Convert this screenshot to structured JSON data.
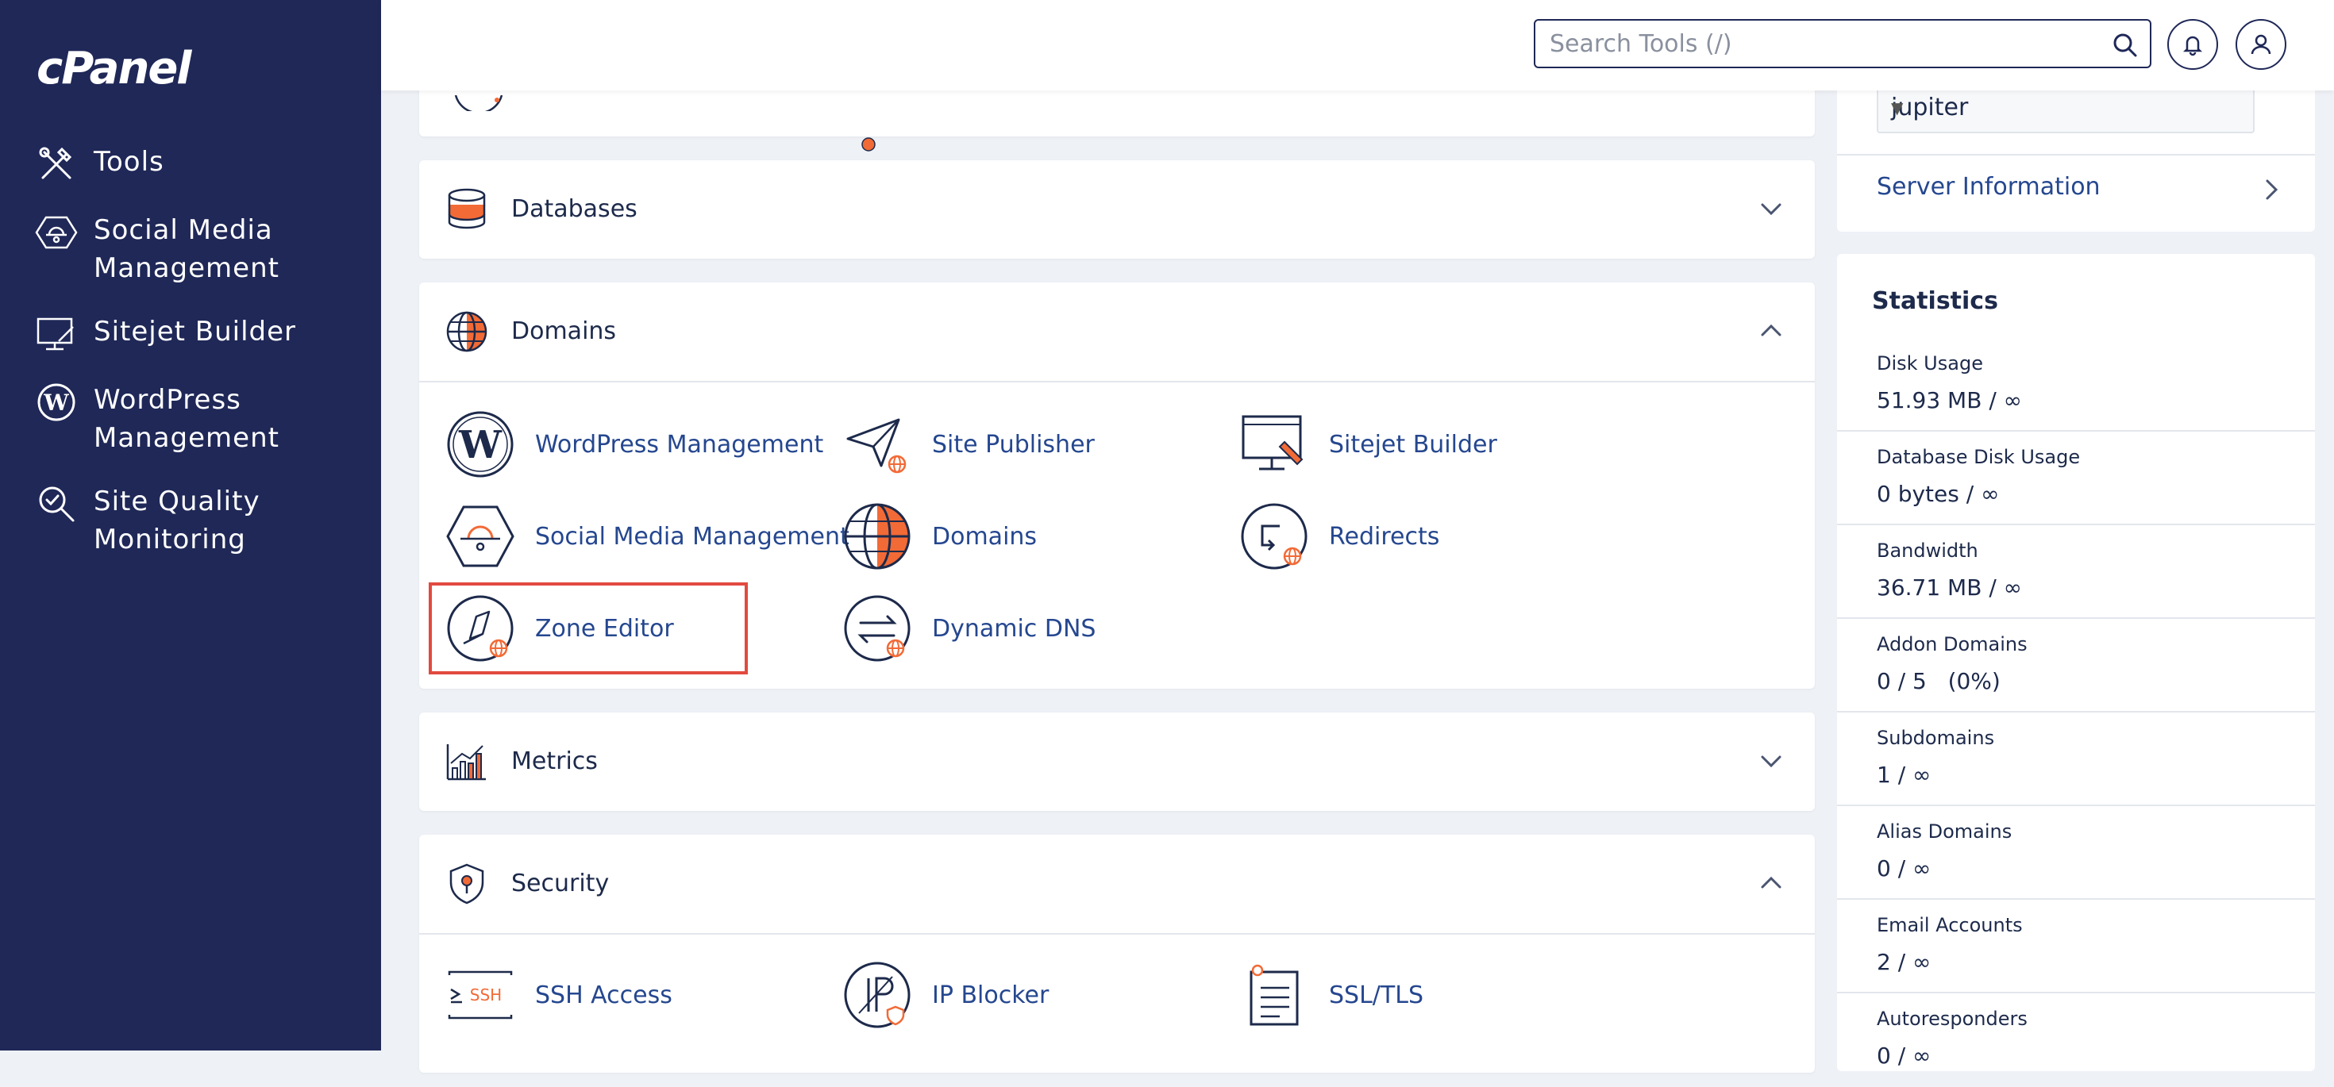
{
  "sidebar": {
    "logo": "cPanel",
    "items": [
      {
        "label": "Tools",
        "icon": "tools-icon"
      },
      {
        "label": "Social Media\nManagement",
        "icon": "social-media-icon"
      },
      {
        "label": "Sitejet Builder",
        "icon": "sitejet-icon"
      },
      {
        "label": "WordPress\nManagement",
        "icon": "wordpress-icon"
      },
      {
        "label": "Site Quality\nMonitoring",
        "icon": "site-quality-icon"
      }
    ]
  },
  "topbar": {
    "search_placeholder": "Search Tools (/)",
    "notifications_icon": "bell-icon",
    "user_icon": "user-icon"
  },
  "main": {
    "databases": {
      "title": "Databases",
      "expanded": false
    },
    "domains": {
      "title": "Domains",
      "expanded": true,
      "tools": [
        {
          "label": "WordPress Management",
          "icon": "wordpress-icon"
        },
        {
          "label": "Site Publisher",
          "icon": "site-publisher-icon"
        },
        {
          "label": "Sitejet Builder",
          "icon": "sitejet-icon"
        },
        {
          "label": "Social Media Management",
          "icon": "social-media-icon"
        },
        {
          "label": "Domains",
          "icon": "domains-globe-icon"
        },
        {
          "label": "Redirects",
          "icon": "redirects-icon"
        },
        {
          "label": "Zone Editor",
          "icon": "zone-editor-icon",
          "highlighted": true
        },
        {
          "label": "Dynamic DNS",
          "icon": "dynamic-dns-icon"
        }
      ]
    },
    "metrics": {
      "title": "Metrics",
      "expanded": false
    },
    "security": {
      "title": "Security",
      "expanded": true,
      "tools": [
        {
          "label": "SSH Access",
          "icon": "ssh-icon"
        },
        {
          "label": "IP Blocker",
          "icon": "ip-blocker-icon"
        },
        {
          "label": "SSL/TLS",
          "icon": "ssl-tls-icon"
        }
      ]
    }
  },
  "right": {
    "theme_value": "jupiter",
    "server_info_label": "Server Information",
    "statistics_title": "Statistics",
    "stats": [
      {
        "name": "Disk Usage",
        "value": "51.93 MB / ∞"
      },
      {
        "name": "Database Disk Usage",
        "value": "0 bytes / ∞"
      },
      {
        "name": "Bandwidth",
        "value": "36.71 MB / ∞"
      },
      {
        "name": "Addon Domains",
        "value": "0 / 5   (0%)"
      },
      {
        "name": "Subdomains",
        "value": "1 / ∞"
      },
      {
        "name": "Alias Domains",
        "value": "0 / ∞"
      },
      {
        "name": "Email Accounts",
        "value": "2 / ∞"
      },
      {
        "name": "Autoresponders",
        "value": "0 / ∞"
      }
    ]
  },
  "colors": {
    "sidebar_bg": "#1f2857",
    "link": "#25478f",
    "accent_orange": "#f26a36",
    "highlight_red": "#e24a3f"
  }
}
